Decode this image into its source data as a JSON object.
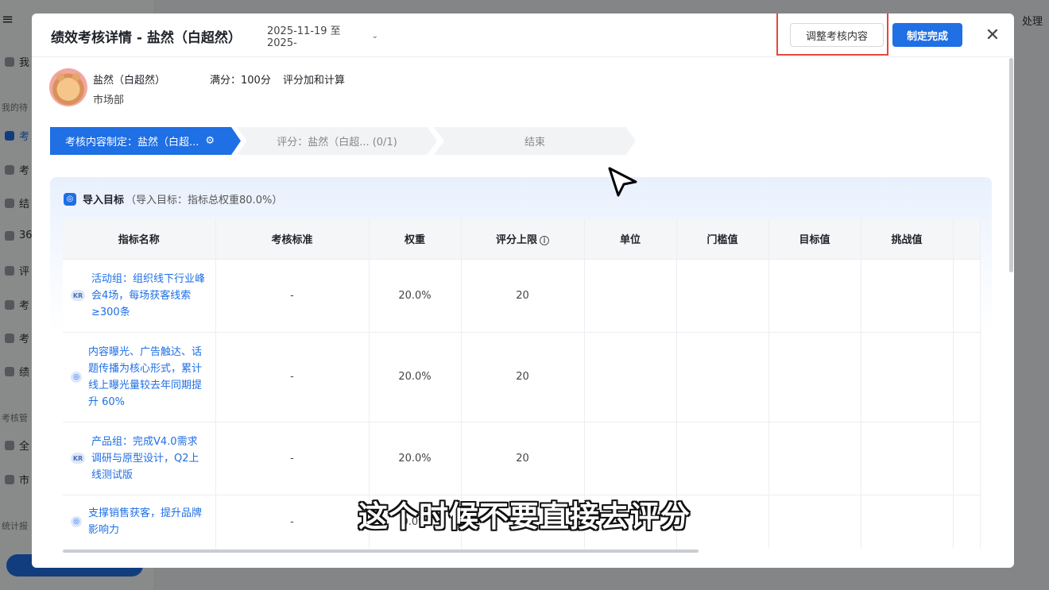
{
  "background": {
    "nav_items": [
      "我",
      "考",
      "考",
      "结",
      "36",
      "评",
      "考",
      "考",
      "绩",
      "全",
      "市"
    ],
    "sections": [
      "我的待",
      "考核管",
      "统计报"
    ],
    "right_button": "处理"
  },
  "modal": {
    "title": "绩效考核详情 - 盐然（白超然）",
    "date_range": "2025-11-19 至 2025-",
    "adjust_label": "调整考核内容",
    "finish_label": "制定完成",
    "close_icon": "close-icon"
  },
  "person": {
    "name": "盐然（白超然）",
    "department": "市场部",
    "full_score": "满分：100分",
    "calc_method": "评分加和计算"
  },
  "steps": [
    {
      "label": "考核内容制定：盐然（白超...",
      "active": true
    },
    {
      "label": "评分：盐然（白超... (0/1)",
      "active": false
    },
    {
      "label": "结束",
      "active": false
    }
  ],
  "target_card": {
    "title": "导入目标",
    "subtitle": "（导入目标：指标总权重80.0%）",
    "columns": [
      "指标名称",
      "考核标准",
      "权重",
      "评分上限",
      "单位",
      "门槛值",
      "目标值",
      "挑战值"
    ],
    "rows": [
      {
        "badge": "KR",
        "name": "活动组：组织线下行业峰会4场，每场获客线索≥300条",
        "standard": "-",
        "weight": "20.0%",
        "cap": "20"
      },
      {
        "badge": "O",
        "name": "内容曝光、广告触达、话题传播为核心形式，累计线上曝光量较去年同期提升 60%",
        "standard": "-",
        "weight": "20.0%",
        "cap": "20"
      },
      {
        "badge": "KR",
        "name": "产品组：完成V4.0需求调研与原型设计，Q2上线测试版",
        "standard": "-",
        "weight": "20.0%",
        "cap": "20"
      },
      {
        "badge": "O",
        "name": "支撑销售获客，提升品牌影响力",
        "standard": "-",
        "weight": "0.0%",
        "cap": ""
      }
    ]
  },
  "subtitle": "这个时候不要直接去评分",
  "colors": {
    "accent": "#1f6fe5",
    "highlight": "#e8453c"
  }
}
